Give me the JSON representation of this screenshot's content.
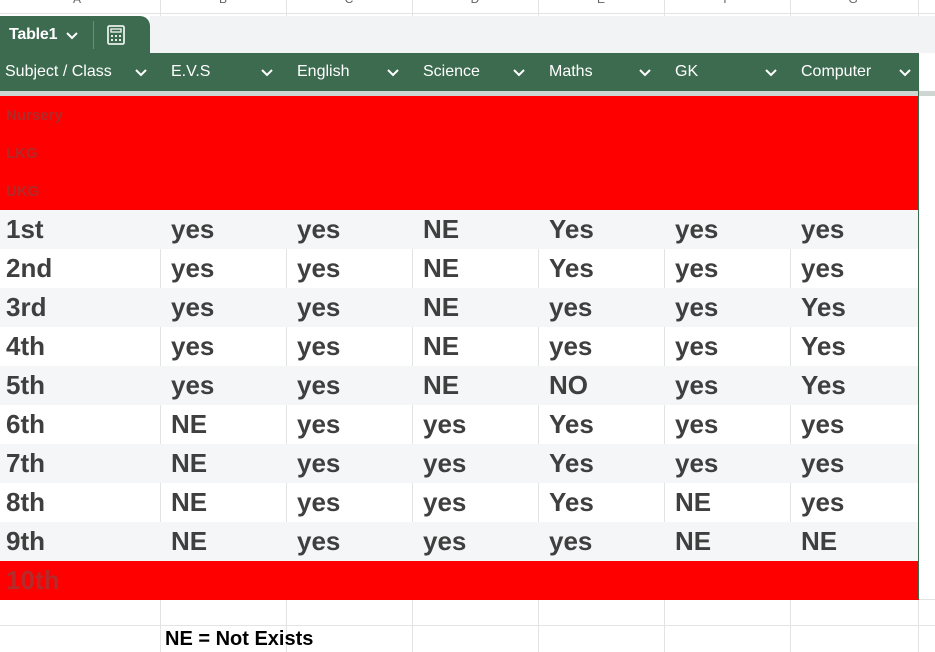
{
  "column_letters": [
    "A",
    "B",
    "C",
    "D",
    "E",
    "F",
    "G"
  ],
  "table": {
    "name": "Table1",
    "calc_icon": "table-calc-icon",
    "accent_color": "#3d6b50",
    "highlight_color": "#ff0000",
    "headers": [
      "Subject / Class",
      "E.V.S",
      "English",
      "Science",
      "Maths",
      "GK",
      "Computer"
    ],
    "highlighted_rows_top": [
      "Nursery",
      "LKG",
      "UKG"
    ],
    "rows": [
      {
        "label": "1st",
        "values": [
          "yes",
          "yes",
          "NE",
          "Yes",
          "yes",
          "yes"
        ]
      },
      {
        "label": "2nd",
        "values": [
          "yes",
          "yes",
          "NE",
          "Yes",
          "yes",
          "yes"
        ]
      },
      {
        "label": "3rd",
        "values": [
          "yes",
          "yes",
          "NE",
          "yes",
          "yes",
          "Yes"
        ]
      },
      {
        "label": "4th",
        "values": [
          "yes",
          "yes",
          "NE",
          "yes",
          "yes",
          "Yes"
        ]
      },
      {
        "label": "5th",
        "values": [
          "yes",
          "yes",
          "NE",
          "NO",
          "yes",
          "Yes"
        ]
      },
      {
        "label": "6th",
        "values": [
          "NE",
          "yes",
          "yes",
          "Yes",
          "yes",
          "yes"
        ]
      },
      {
        "label": "7th",
        "values": [
          "NE",
          "yes",
          "yes",
          "Yes",
          "yes",
          "yes"
        ]
      },
      {
        "label": "8th",
        "values": [
          "NE",
          "yes",
          "yes",
          "Yes",
          "NE",
          "yes"
        ]
      },
      {
        "label": "9th",
        "values": [
          "NE",
          "yes",
          "yes",
          "yes",
          "NE",
          "NE"
        ]
      }
    ],
    "highlighted_row_bottom": "10th"
  },
  "note": "NE = Not Exists"
}
